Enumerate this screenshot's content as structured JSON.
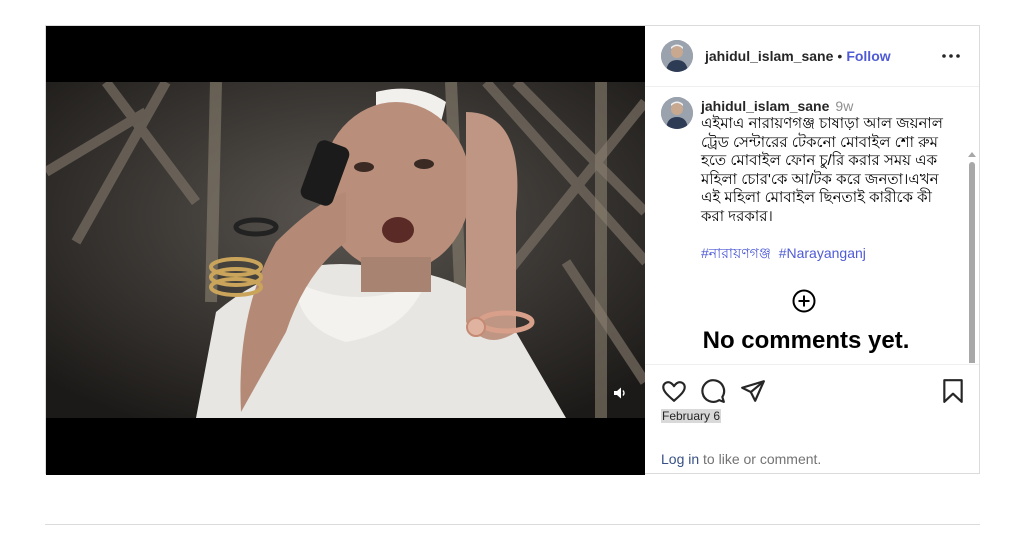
{
  "header": {
    "username": "jahidul_islam_sane",
    "separator": "•",
    "follow_label": "Follow"
  },
  "caption": {
    "username": "jahidul_islam_sane",
    "time": "9w",
    "text": "এইমাএ নারায়ণগঞ্জ চাষাড়া আল জয়নাল ট্রেড সেন্টারের টেকনো মোবাইল শো রুম হতে মোবাইল ফোন চু/রি করার সময় এক মহিলা চোর'কে আ/টক করে জনতা।এখন এই মহিলা মোবাইল ছিনতাই কারীকে কী করা দরকার।",
    "hashtags": [
      "#নারায়ণগঞ্জ",
      "#Narayanganj"
    ]
  },
  "comments": {
    "empty_text": "No comments yet."
  },
  "footer": {
    "date": "February 6",
    "login_link": "Log in",
    "login_suffix": " to like or comment."
  },
  "icons": {
    "like": "heart-icon",
    "comment": "comment-icon",
    "share": "share-icon",
    "save": "bookmark-icon",
    "more": "more-options-icon",
    "audio": "speaker-icon",
    "add_comment": "plus-circle-icon"
  },
  "colors": {
    "link": "#4f5bd5",
    "border": "#dbdbdb",
    "muted": "#737373"
  }
}
